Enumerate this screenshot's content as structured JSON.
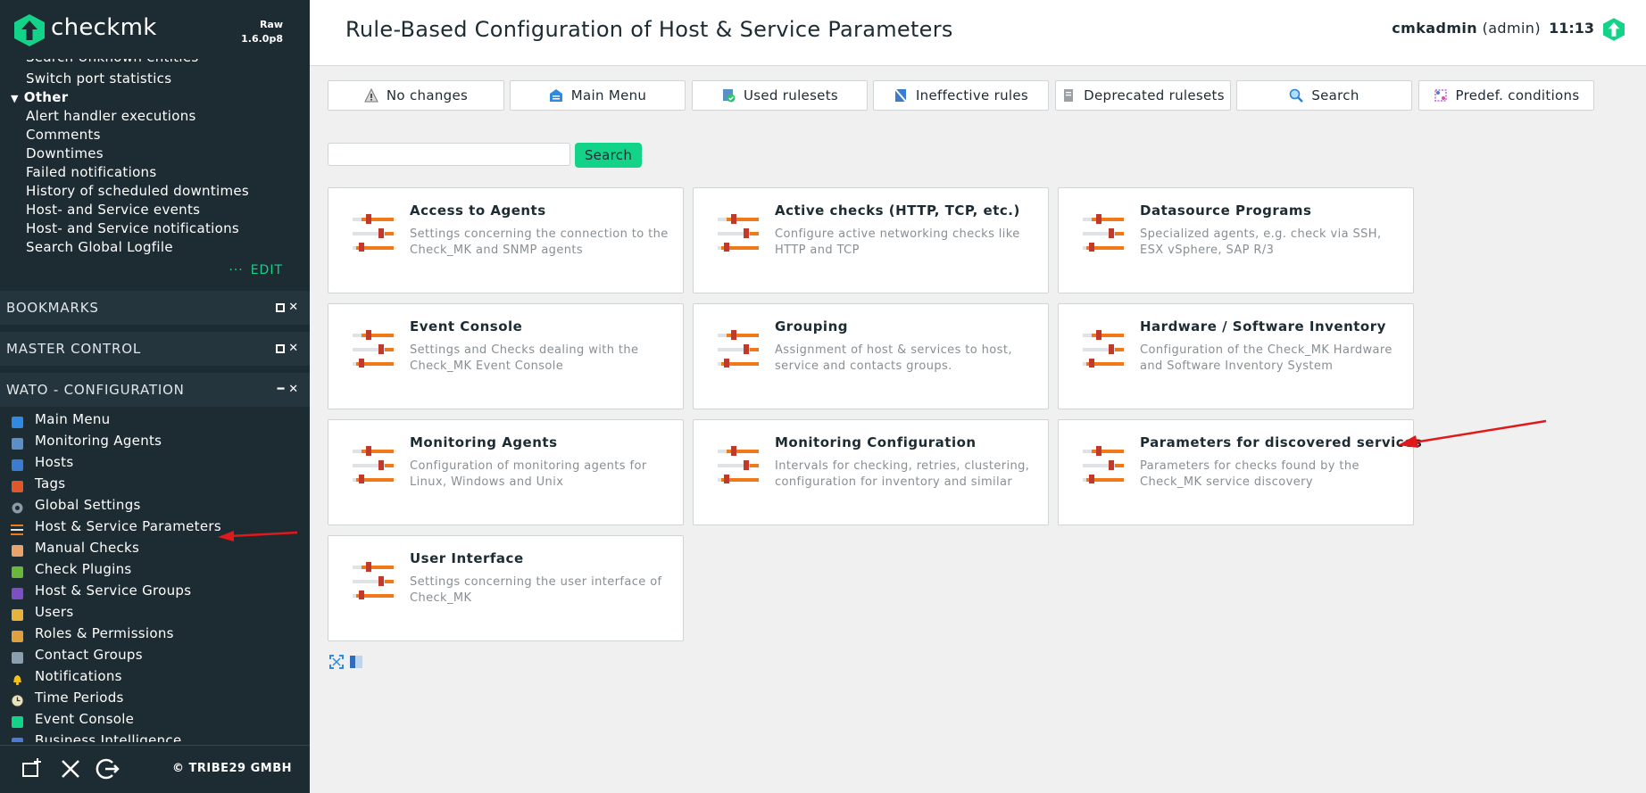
{
  "brand": {
    "name": "checkmk",
    "edition": "Raw",
    "version": "1.6.0p8"
  },
  "sidebar": {
    "views_items_partial": "Search Unknown entities",
    "views_items": [
      "Switch port statistics"
    ],
    "other_group": "Other",
    "other_items": [
      "Alert handler executions",
      "Comments",
      "Downtimes",
      "Failed notifications",
      "History of scheduled downtimes",
      "Host- and Service events",
      "Host- and Service notifications",
      "Search Global Logfile"
    ],
    "edit_label": "EDIT",
    "bookmarks_title": "BOOKMARKS",
    "master_control_title": "MASTER CONTROL",
    "wato_title": "WATO - CONFIGURATION",
    "wato_items": [
      {
        "label": "Main Menu",
        "icon": "main-menu-icon"
      },
      {
        "label": "Monitoring Agents",
        "icon": "agents-icon"
      },
      {
        "label": "Hosts",
        "icon": "hosts-icon"
      },
      {
        "label": "Tags",
        "icon": "tags-icon"
      },
      {
        "label": "Global Settings",
        "icon": "gear-icon"
      },
      {
        "label": "Host & Service Parameters",
        "icon": "rulesets-icon"
      },
      {
        "label": "Manual Checks",
        "icon": "hand-icon"
      },
      {
        "label": "Check Plugins",
        "icon": "puzzle-icon"
      },
      {
        "label": "Host & Service Groups",
        "icon": "groups-icon"
      },
      {
        "label": "Users",
        "icon": "users-icon"
      },
      {
        "label": "Roles & Permissions",
        "icon": "roles-icon"
      },
      {
        "label": "Contact Groups",
        "icon": "contact-groups-icon"
      },
      {
        "label": "Notifications",
        "icon": "bell-icon"
      },
      {
        "label": "Time Periods",
        "icon": "clock-icon"
      },
      {
        "label": "Event Console",
        "icon": "event-console-icon"
      },
      {
        "label": "Business Intelligence",
        "icon": "bi-icon"
      }
    ],
    "copyright": "© TRIBE29 GMBH"
  },
  "header": {
    "title": "Rule-Based Configuration of Host & Service Parameters",
    "user": "cmkadmin",
    "role": "(admin)",
    "time": "11:13"
  },
  "toolbar": {
    "buttons": [
      {
        "label": "No changes",
        "icon": "warning-icon"
      },
      {
        "label": "Main Menu",
        "icon": "main-menu-icon"
      },
      {
        "label": "Used rulesets",
        "icon": "used-rulesets-icon"
      },
      {
        "label": "Ineffective rules",
        "icon": "ineffective-icon"
      },
      {
        "label": "Deprecated rulesets",
        "icon": "deprecated-icon"
      },
      {
        "label": "Search",
        "icon": "search-icon"
      },
      {
        "label": "Predef. conditions",
        "icon": "conditions-icon"
      }
    ]
  },
  "search": {
    "value": "",
    "button_label": "Search"
  },
  "groups": [
    {
      "title": "Access to Agents",
      "desc": "Settings concerning the connection to the Check_MK and SNMP agents"
    },
    {
      "title": "Active checks (HTTP, TCP, etc.)",
      "desc": "Configure active networking checks like HTTP and TCP"
    },
    {
      "title": "Datasource Programs",
      "desc": "Specialized agents, e.g. check via SSH, ESX vSphere, SAP R/3"
    },
    {
      "title": "Event Console",
      "desc": "Settings and Checks dealing with the Check_MK Event Console"
    },
    {
      "title": "Grouping",
      "desc": "Assignment of host & services to host, service and contacts groups."
    },
    {
      "title": "Hardware / Software Inventory",
      "desc": "Configuration of the Check_MK Hardware and Software Inventory System"
    },
    {
      "title": "Monitoring Agents",
      "desc": "Configuration of monitoring agents for Linux, Windows and Unix"
    },
    {
      "title": "Monitoring Configuration",
      "desc": "Intervals for checking, retries, clustering, configuration for inventory and similar"
    },
    {
      "title": "Parameters for discovered services",
      "desc": "Parameters for checks found by the Check_MK service discovery"
    },
    {
      "title": "User Interface",
      "desc": "Settings concerning the user interface of Check_MK"
    }
  ],
  "colors": {
    "accent": "#13d389",
    "sidebar_bg": "#1d2b33",
    "slider_orange": "#f07a1a",
    "arrow_red": "#e0191b"
  }
}
